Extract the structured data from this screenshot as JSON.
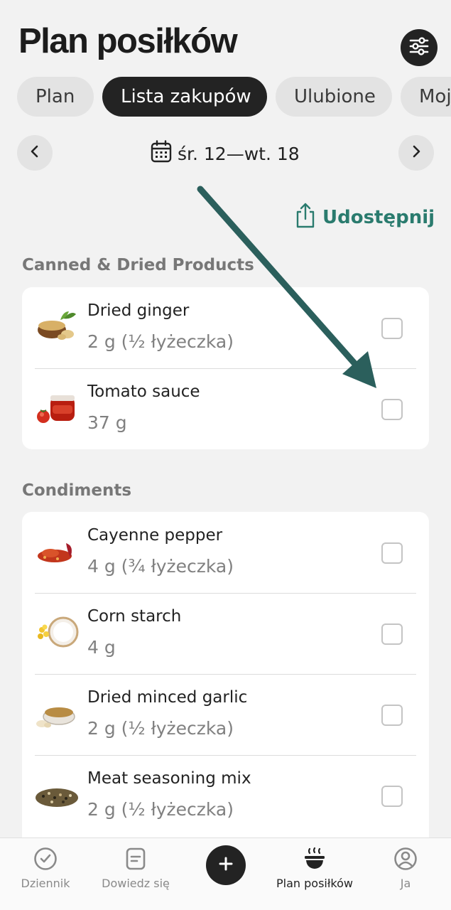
{
  "header": {
    "title": "Plan posiłków",
    "filter_icon": "sliders-icon"
  },
  "tabs": [
    {
      "label": "Plan",
      "active": false
    },
    {
      "label": "Lista zakupów",
      "active": true
    },
    {
      "label": "Ulubione",
      "active": false
    },
    {
      "label": "Moj",
      "active": false
    }
  ],
  "date_nav": {
    "range": "śr. 12—wt. 18",
    "prev_icon": "chevron-left-icon",
    "next_icon": "chevron-right-icon",
    "calendar_icon": "calendar-icon"
  },
  "share": {
    "label": "Udostępnij",
    "icon": "share-icon"
  },
  "sections": [
    {
      "title": "Canned & Dried Products",
      "items": [
        {
          "name": "Dried ginger",
          "qty": "2 g (½ łyżeczka)",
          "checked": false
        },
        {
          "name": "Tomato sauce",
          "qty": "37 g",
          "checked": false
        }
      ]
    },
    {
      "title": "Condiments",
      "items": [
        {
          "name": "Cayenne pepper",
          "qty": "4 g (¾ łyżeczka)",
          "checked": false
        },
        {
          "name": "Corn starch",
          "qty": "4 g",
          "checked": false
        },
        {
          "name": "Dried minced garlic",
          "qty": "2 g (½ łyżeczka)",
          "checked": false
        },
        {
          "name": "Meat seasoning mix",
          "qty": "2 g (½ łyżeczka)",
          "checked": false
        }
      ]
    }
  ],
  "bottom_nav": [
    {
      "label": "Dziennik",
      "icon": "check-circle-icon",
      "active": false
    },
    {
      "label": "Dowiedz się",
      "icon": "document-icon",
      "active": false
    },
    {
      "label": "",
      "icon": "plus-icon",
      "active": false
    },
    {
      "label": "Plan posiłków",
      "icon": "bowl-icon",
      "active": true
    },
    {
      "label": "Ja",
      "icon": "user-icon",
      "active": false
    }
  ],
  "colors": {
    "accent": "#2a7b6e",
    "dark": "#232323",
    "arrow": "#2b5f5c"
  }
}
